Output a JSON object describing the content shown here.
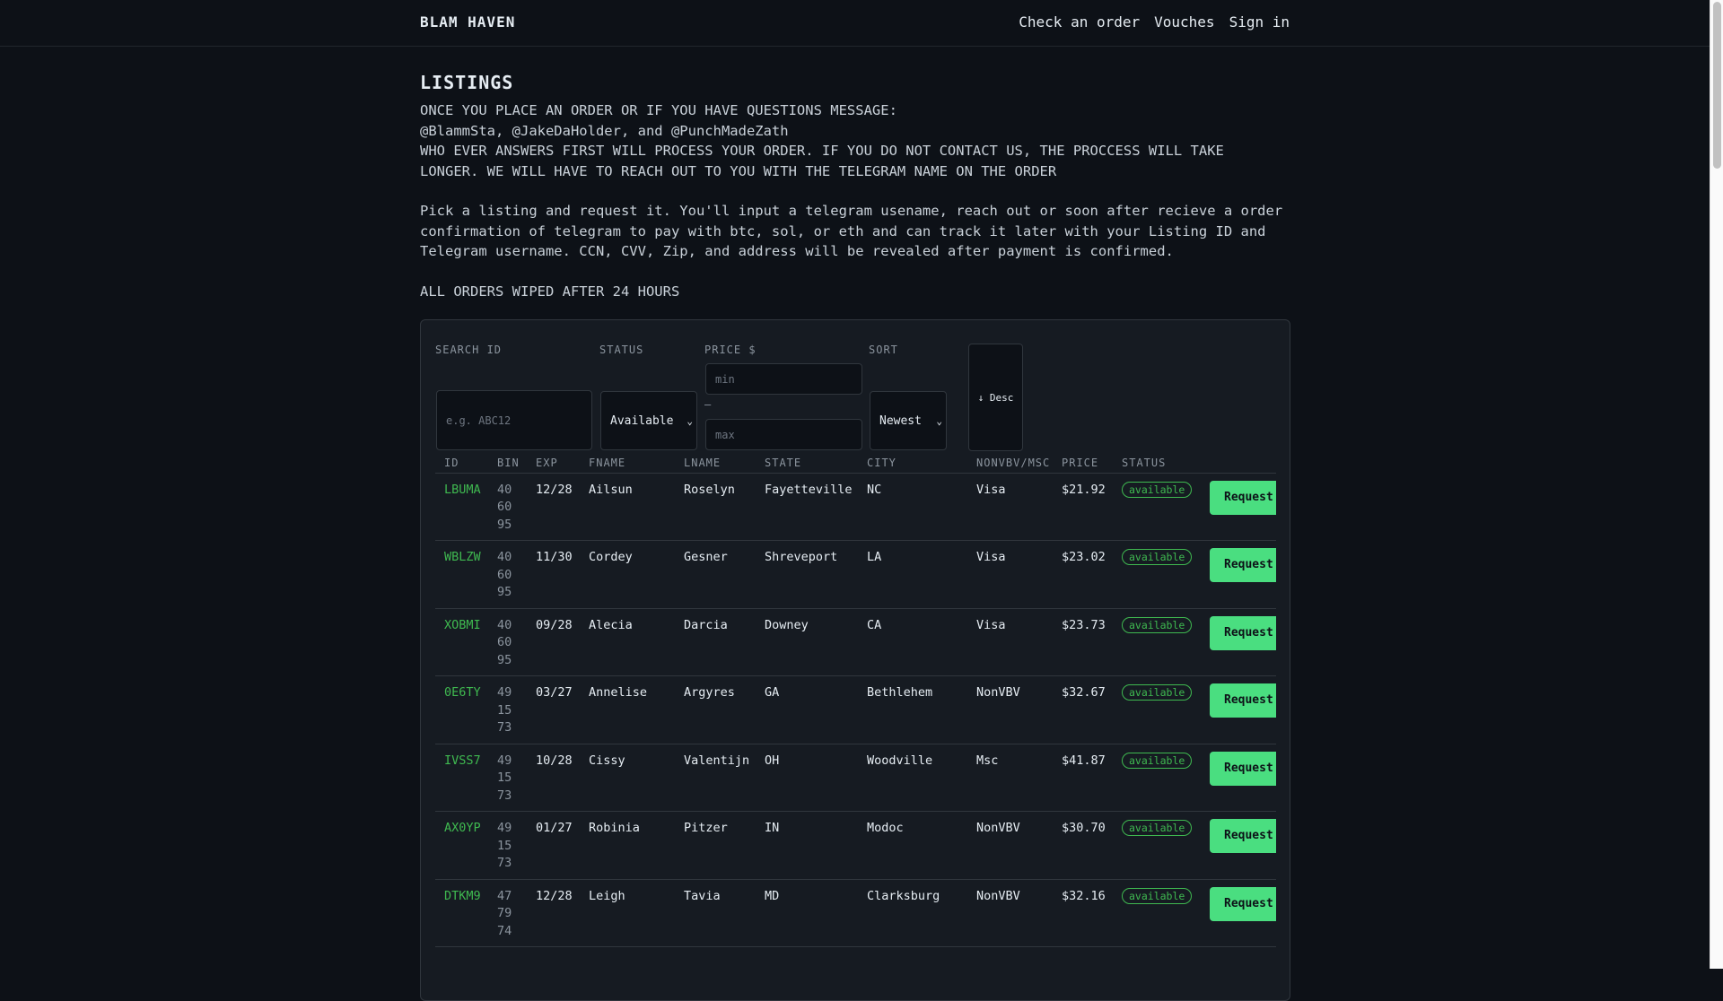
{
  "header": {
    "brand": "BLAM HAVEN",
    "nav": [
      "Check an order",
      "Vouches",
      "Sign in"
    ]
  },
  "intro": {
    "title": "LISTINGS",
    "line1": "ONCE YOU PLACE AN ORDER OR IF YOU HAVE QUESTIONS MESSAGE:",
    "line2": "@BlammSta, @JakeDaHolder, and @PunchMadeZath",
    "line3": "WHO EVER ANSWERS FIRST WILL PROCESS YOUR ORDER. IF YOU DO NOT CONTACT US, THE PROCCESS WILL TAKE LONGER. WE WILL HAVE TO REACH OUT TO YOU WITH THE TELEGRAM NAME ON THE ORDER",
    "para2": "Pick a listing and request it. You'll input a telegram usename, reach out or soon after recieve a order confirmation of telegram to pay with btc, sol, or eth and can track it later with your Listing ID and Telegram username. CCN, CVV, Zip, and address will be revealed after payment is confirmed.",
    "para3": "ALL ORDERS WIPED AFTER 24 HOURS"
  },
  "filters": {
    "search_label": "SEARCH ID",
    "search_placeholder": "e.g. ABC12",
    "status_label": "STATUS",
    "status_value": "Available",
    "price_label": "PRICE $",
    "price_min_placeholder": "min",
    "price_max_placeholder": "max",
    "price_dash": "—",
    "sort_label": "SORT",
    "sort_value": "Newest",
    "order_button": "↓ Desc"
  },
  "table": {
    "columns": [
      "ID",
      "BIN",
      "EXP",
      "FNAME",
      "LNAME",
      "STATE",
      "CITY",
      "NONVBV/MSC",
      "PRICE",
      "STATUS",
      ""
    ],
    "action_label": "Request",
    "rows": [
      {
        "id": "LBUMA",
        "bin": [
          "40",
          "60",
          "95"
        ],
        "exp": "12/28",
        "fname": "Ailsun",
        "lname": "Roselyn",
        "state": "Fayetteville",
        "city": "NC",
        "type": "Visa",
        "price": "$21.92",
        "status": "available"
      },
      {
        "id": "WBLZW",
        "bin": [
          "40",
          "60",
          "95"
        ],
        "exp": "11/30",
        "fname": "Cordey",
        "lname": "Gesner",
        "state": "Shreveport",
        "city": "LA",
        "type": "Visa",
        "price": "$23.02",
        "status": "available"
      },
      {
        "id": "XOBMI",
        "bin": [
          "40",
          "60",
          "95"
        ],
        "exp": "09/28",
        "fname": "Alecia",
        "lname": "Darcia",
        "state": "Downey",
        "city": "CA",
        "type": "Visa",
        "price": "$23.73",
        "status": "available"
      },
      {
        "id": "0E6TY",
        "bin": [
          "49",
          "15",
          "73"
        ],
        "exp": "03/27",
        "fname": "Annelise",
        "lname": "Argyres",
        "state": "GA",
        "city": "Bethlehem",
        "type": "NonVBV",
        "price": "$32.67",
        "status": "available"
      },
      {
        "id": "IVSS7",
        "bin": [
          "49",
          "15",
          "73"
        ],
        "exp": "10/28",
        "fname": "Cissy",
        "lname": "Valentijn",
        "state": "OH",
        "city": "Woodville",
        "type": "Msc",
        "price": "$41.87",
        "status": "available"
      },
      {
        "id": "AX0YP",
        "bin": [
          "49",
          "15",
          "73"
        ],
        "exp": "01/27",
        "fname": "Robinia",
        "lname": "Pitzer",
        "state": "IN",
        "city": "Modoc",
        "type": "NonVBV",
        "price": "$30.70",
        "status": "available"
      },
      {
        "id": "DTKM9",
        "bin": [
          "47",
          "79",
          "74"
        ],
        "exp": "12/28",
        "fname": "Leigh",
        "lname": "Tavia",
        "state": "MD",
        "city": "Clarksburg",
        "type": "NonVBV",
        "price": "$32.16",
        "status": "available"
      }
    ]
  }
}
